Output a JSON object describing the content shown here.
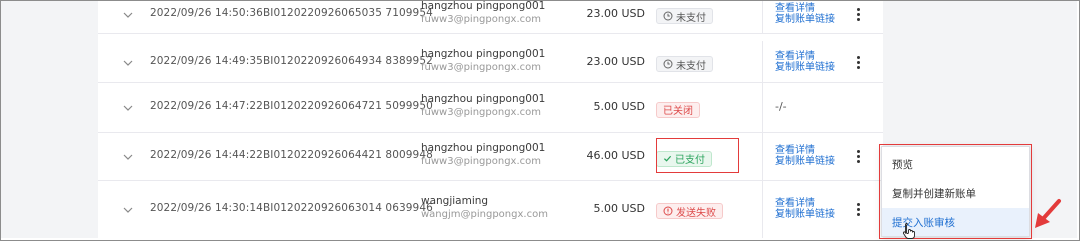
{
  "rows": [
    {
      "date": "2022/09/26 14:50:36",
      "bill_no": "BI0120220926065035 7109954",
      "customer_name": "hangzhou pingpong001",
      "customer_email": "fuww3@pingpongx.com",
      "amount": "23.00 USD",
      "status": {
        "label": "未支付",
        "type": "unpaid",
        "icon": "clock-icon"
      },
      "actions": [
        "查看详情",
        "复制账单链接"
      ]
    },
    {
      "date": "2022/09/26 14:49:35",
      "bill_no": "BI0120220926064934 8389952",
      "customer_name": "hangzhou pingpong001",
      "customer_email": "fuww3@pingpongx.com",
      "amount": "23.00 USD",
      "status": {
        "label": "未支付",
        "type": "unpaid",
        "icon": "clock-icon"
      },
      "actions": [
        "查看详情",
        "复制账单链接"
      ]
    },
    {
      "date": "2022/09/26 14:47:22",
      "bill_no": "BI0120220926064721 5099950",
      "customer_name": "hangzhou pingpong001",
      "customer_email": "fuww3@pingpongx.com",
      "amount": "5.00 USD",
      "status": {
        "label": "已关闭",
        "type": "closed",
        "icon": ""
      },
      "actions": [
        "-/-"
      ]
    },
    {
      "date": "2022/09/26 14:44:22",
      "bill_no": "BI0120220926064421 8009948",
      "customer_name": "hangzhou pingpong001",
      "customer_email": "fuww3@pingpongx.com",
      "amount": "46.00 USD",
      "status": {
        "label": "已支付",
        "type": "paid",
        "icon": "check-icon"
      },
      "actions": [
        "查看详情",
        "复制账单链接"
      ]
    },
    {
      "date": "2022/09/26 14:30:14",
      "bill_no": "BI0120220926063014 0639946",
      "customer_name": "wangjiaming",
      "customer_email": "wangjm@pingpongx.com",
      "amount": "5.00 USD",
      "status": {
        "label": "发送失败",
        "type": "failed",
        "icon": "alert-icon"
      },
      "actions": [
        "查看详情",
        "复制账单链接"
      ]
    }
  ],
  "context_menu": {
    "items": [
      "预览",
      "复制并创建新账单",
      "提交入账审核"
    ],
    "hovered_index": 2
  },
  "colors": {
    "link": "#1f6fd1",
    "highlight_annotation": "#e33b3b",
    "paid": "#2aa35c",
    "error": "#dd4a4a"
  }
}
